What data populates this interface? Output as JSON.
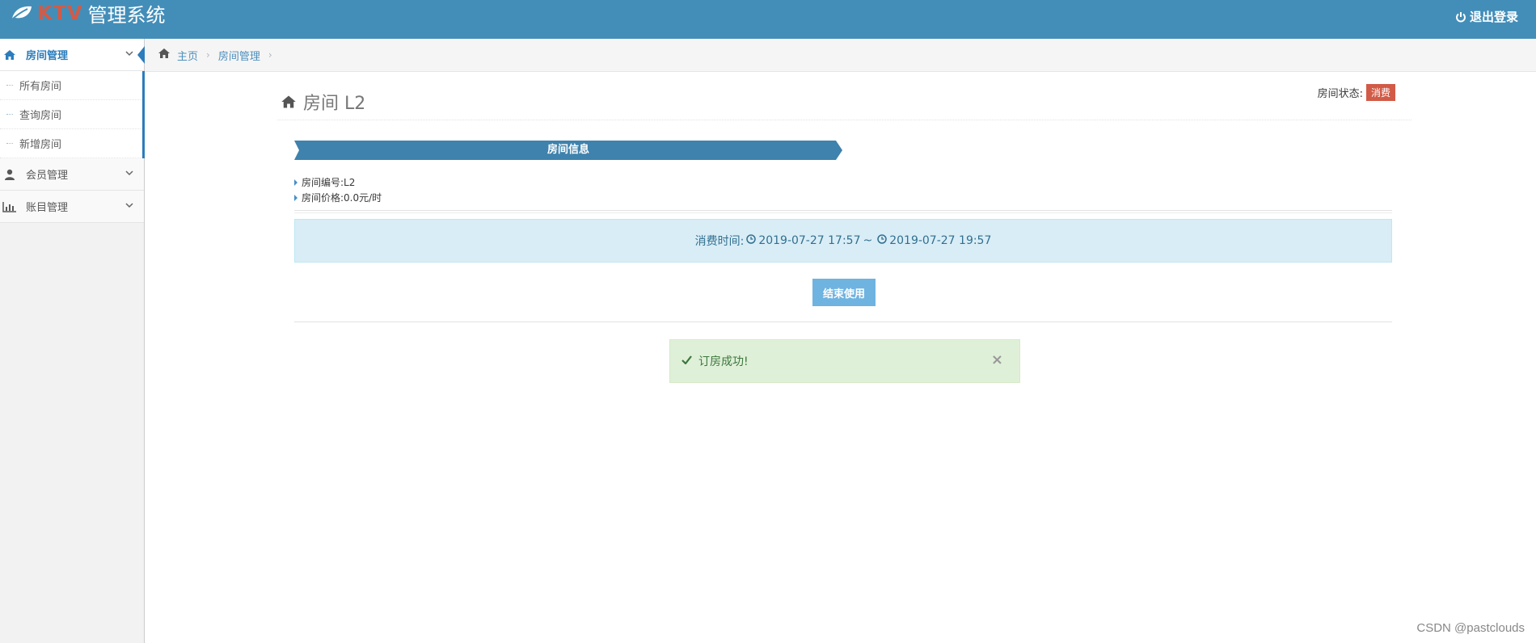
{
  "navbar": {
    "brand_ktv": "KTV",
    "brand_title": "管理系统",
    "logout_label": "退出登录"
  },
  "sidebar": {
    "items": [
      {
        "label": "房间管理",
        "icon": "home-icon",
        "active": true,
        "children": [
          {
            "label": "所有房间"
          },
          {
            "label": "查询房间"
          },
          {
            "label": "新增房间"
          }
        ]
      },
      {
        "label": "会员管理",
        "icon": "user-icon"
      },
      {
        "label": "账目管理",
        "icon": "bar-chart-icon"
      }
    ]
  },
  "breadcrumb": {
    "home": "主页",
    "current": "房间管理"
  },
  "page": {
    "title": "房间 L2",
    "status_label": "房间状态:",
    "status_badge": "消费",
    "section_title": "房间信息",
    "room_no_label": "房间编号:",
    "room_no": "L2",
    "price_label": "房间价格:",
    "price": "0.0元/时",
    "time_label": "消费时间:",
    "start_time": "2019-07-27 17:57",
    "time_sep": "~",
    "end_time": "2019-07-27 19:57",
    "end_button": "结束使用",
    "success_msg": "订房成功!",
    "close_symbol": "×"
  },
  "watermark": "CSDN @pastclouds",
  "colors": {
    "navbar": "#438eb9",
    "accent": "#2b7dbc",
    "badge": "#d15b47",
    "ribbon": "#3e82ad",
    "info_bg": "#d9edf7",
    "success_bg": "#dff0d8",
    "button": "#6fb3e0"
  }
}
